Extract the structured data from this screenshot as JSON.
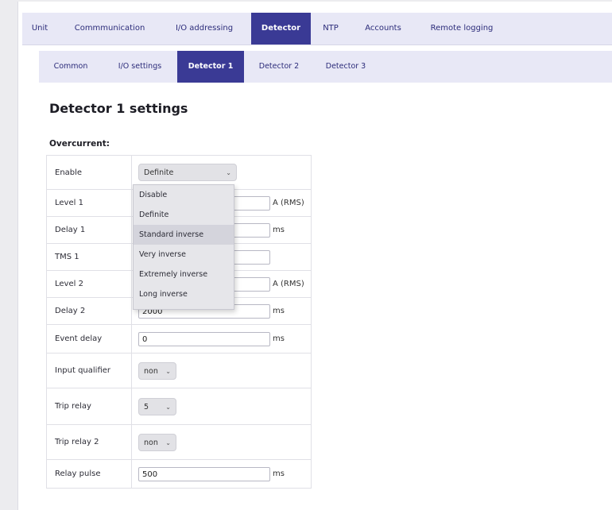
{
  "main_tabs": [
    {
      "label": "Unit",
      "active": false
    },
    {
      "label": "Commmunication",
      "active": false
    },
    {
      "label": "I/O addressing",
      "active": false
    },
    {
      "label": "Detector",
      "active": true
    },
    {
      "label": "NTP",
      "active": false
    },
    {
      "label": "Accounts",
      "active": false
    },
    {
      "label": "Remote logging",
      "active": false
    }
  ],
  "sub_tabs": [
    {
      "label": "Common",
      "active": false
    },
    {
      "label": "I/O settings",
      "active": false
    },
    {
      "label": "Detector 1",
      "active": true
    },
    {
      "label": "Detector 2",
      "active": false
    },
    {
      "label": "Detector 3",
      "active": false
    }
  ],
  "page_title": "Detector 1 settings",
  "section_label": "Overcurrent:",
  "rows": {
    "enable": {
      "label": "Enable",
      "selected": "Definite"
    },
    "level1": {
      "label": "Level 1",
      "value": "",
      "unit": "A (RMS)"
    },
    "delay1": {
      "label": "Delay 1",
      "value": "",
      "unit": "ms"
    },
    "tms1": {
      "label": "TMS 1",
      "value": ""
    },
    "level2": {
      "label": "Level 2",
      "value": "",
      "unit": "A (RMS)"
    },
    "delay2": {
      "label": "Delay 2",
      "value": "2000",
      "unit": "ms"
    },
    "event_delay": {
      "label": "Event delay",
      "value": "0",
      "unit": "ms"
    },
    "input_qualifier": {
      "label": "Input qualifier",
      "selected": "non"
    },
    "trip_relay": {
      "label": "Trip relay",
      "selected": "5"
    },
    "trip_relay2": {
      "label": "Trip relay 2",
      "selected": "non"
    },
    "relay_pulse": {
      "label": "Relay pulse",
      "value": "500",
      "unit": "ms"
    }
  },
  "enable_options": [
    "Disable",
    "Definite",
    "Standard inverse",
    "Very inverse",
    "Extremely inverse",
    "Long inverse"
  ],
  "icons": {
    "select_arrow": "chevron-down-icon"
  },
  "colors": {
    "accent": "#3a3a95",
    "tab_bg": "#e8e8f6",
    "select_bg": "#e2e2e6"
  }
}
